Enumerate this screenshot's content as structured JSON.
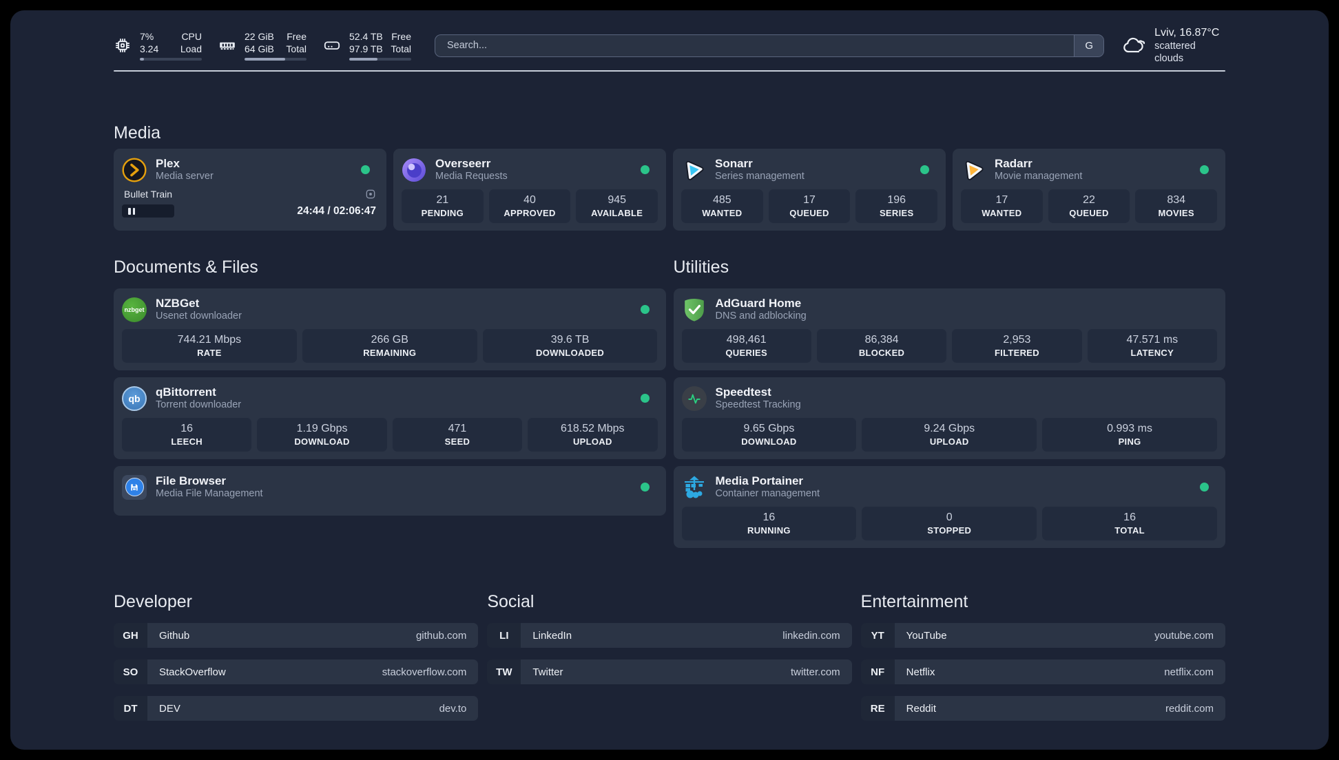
{
  "header": {
    "system_stats": [
      {
        "icon": "cpu",
        "rows": [
          {
            "value": "7%",
            "label": "CPU"
          },
          {
            "value": "3.24",
            "label": "Load"
          }
        ],
        "progress": 7
      },
      {
        "icon": "memory",
        "rows": [
          {
            "value": "22 GiB",
            "label": "Free"
          },
          {
            "value": "64 GiB",
            "label": "Total"
          }
        ],
        "progress": 66
      },
      {
        "icon": "disk",
        "rows": [
          {
            "value": "52.4 TB",
            "label": "Free"
          },
          {
            "value": "97.9 TB",
            "label": "Total"
          }
        ],
        "progress": 46
      }
    ],
    "search": {
      "placeholder": "Search...",
      "provider_label": "G"
    },
    "weather": {
      "location": "Lviv, 16.87°C",
      "condition": "scattered clouds"
    }
  },
  "sections": {
    "media": "Media",
    "documents": "Documents & Files",
    "utilities": "Utilities"
  },
  "services": {
    "plex": {
      "name": "Plex",
      "desc": "Media server",
      "status": "online",
      "now_playing": "Bullet Train",
      "progress_time": "24:44 / 02:06:47"
    },
    "overseerr": {
      "name": "Overseerr",
      "desc": "Media Requests",
      "status": "online",
      "stats": [
        {
          "value": "21",
          "label": "PENDING"
        },
        {
          "value": "40",
          "label": "APPROVED"
        },
        {
          "value": "945",
          "label": "AVAILABLE"
        }
      ]
    },
    "sonarr": {
      "name": "Sonarr",
      "desc": "Series management",
      "status": "online",
      "stats": [
        {
          "value": "485",
          "label": "WANTED"
        },
        {
          "value": "17",
          "label": "QUEUED"
        },
        {
          "value": "196",
          "label": "SERIES"
        }
      ]
    },
    "radarr": {
      "name": "Radarr",
      "desc": "Movie management",
      "status": "online",
      "stats": [
        {
          "value": "17",
          "label": "WANTED"
        },
        {
          "value": "22",
          "label": "QUEUED"
        },
        {
          "value": "834",
          "label": "MOVIES"
        }
      ]
    },
    "nzbget": {
      "name": "NZBGet",
      "desc": "Usenet downloader",
      "status": "online",
      "stats": [
        {
          "value": "744.21 Mbps",
          "label": "RATE"
        },
        {
          "value": "266 GB",
          "label": "REMAINING"
        },
        {
          "value": "39.6 TB",
          "label": "DOWNLOADED"
        }
      ]
    },
    "qbittorrent": {
      "name": "qBittorrent",
      "desc": "Torrent downloader",
      "status": "online",
      "stats": [
        {
          "value": "16",
          "label": "LEECH"
        },
        {
          "value": "1.19 Gbps",
          "label": "DOWNLOAD"
        },
        {
          "value": "471",
          "label": "SEED"
        },
        {
          "value": "618.52 Mbps",
          "label": "UPLOAD"
        }
      ]
    },
    "filebrowser": {
      "name": "File Browser",
      "desc": "Media File Management",
      "status": "online"
    },
    "adguard": {
      "name": "AdGuard Home",
      "desc": "DNS and adblocking",
      "stats": [
        {
          "value": "498,461",
          "label": "QUERIES"
        },
        {
          "value": "86,384",
          "label": "BLOCKED"
        },
        {
          "value": "2,953",
          "label": "FILTERED"
        },
        {
          "value": "47.571 ms",
          "label": "LATENCY"
        }
      ]
    },
    "speedtest": {
      "name": "Speedtest",
      "desc": "Speedtest Tracking",
      "stats": [
        {
          "value": "9.65 Gbps",
          "label": "DOWNLOAD"
        },
        {
          "value": "9.24 Gbps",
          "label": "UPLOAD"
        },
        {
          "value": "0.993 ms",
          "label": "PING"
        }
      ]
    },
    "portainer": {
      "name": "Media Portainer",
      "desc": "Container management",
      "status": "online",
      "stats": [
        {
          "value": "16",
          "label": "RUNNING"
        },
        {
          "value": "0",
          "label": "STOPPED"
        },
        {
          "value": "16",
          "label": "TOTAL"
        }
      ]
    }
  },
  "bookmarks": {
    "developer": {
      "title": "Developer",
      "items": [
        {
          "abbr": "GH",
          "name": "Github",
          "url": "github.com"
        },
        {
          "abbr": "SO",
          "name": "StackOverflow",
          "url": "stackoverflow.com"
        },
        {
          "abbr": "DT",
          "name": "DEV",
          "url": "dev.to"
        }
      ]
    },
    "social": {
      "title": "Social",
      "items": [
        {
          "abbr": "LI",
          "name": "LinkedIn",
          "url": "linkedin.com"
        },
        {
          "abbr": "TW",
          "name": "Twitter",
          "url": "twitter.com"
        }
      ]
    },
    "entertainment": {
      "title": "Entertainment",
      "items": [
        {
          "abbr": "YT",
          "name": "YouTube",
          "url": "youtube.com"
        },
        {
          "abbr": "NF",
          "name": "Netflix",
          "url": "netflix.com"
        },
        {
          "abbr": "RE",
          "name": "Reddit",
          "url": "reddit.com"
        }
      ]
    }
  },
  "colors": {
    "status_online": "#2bc48a",
    "plex_accent": "#e5a00d"
  }
}
